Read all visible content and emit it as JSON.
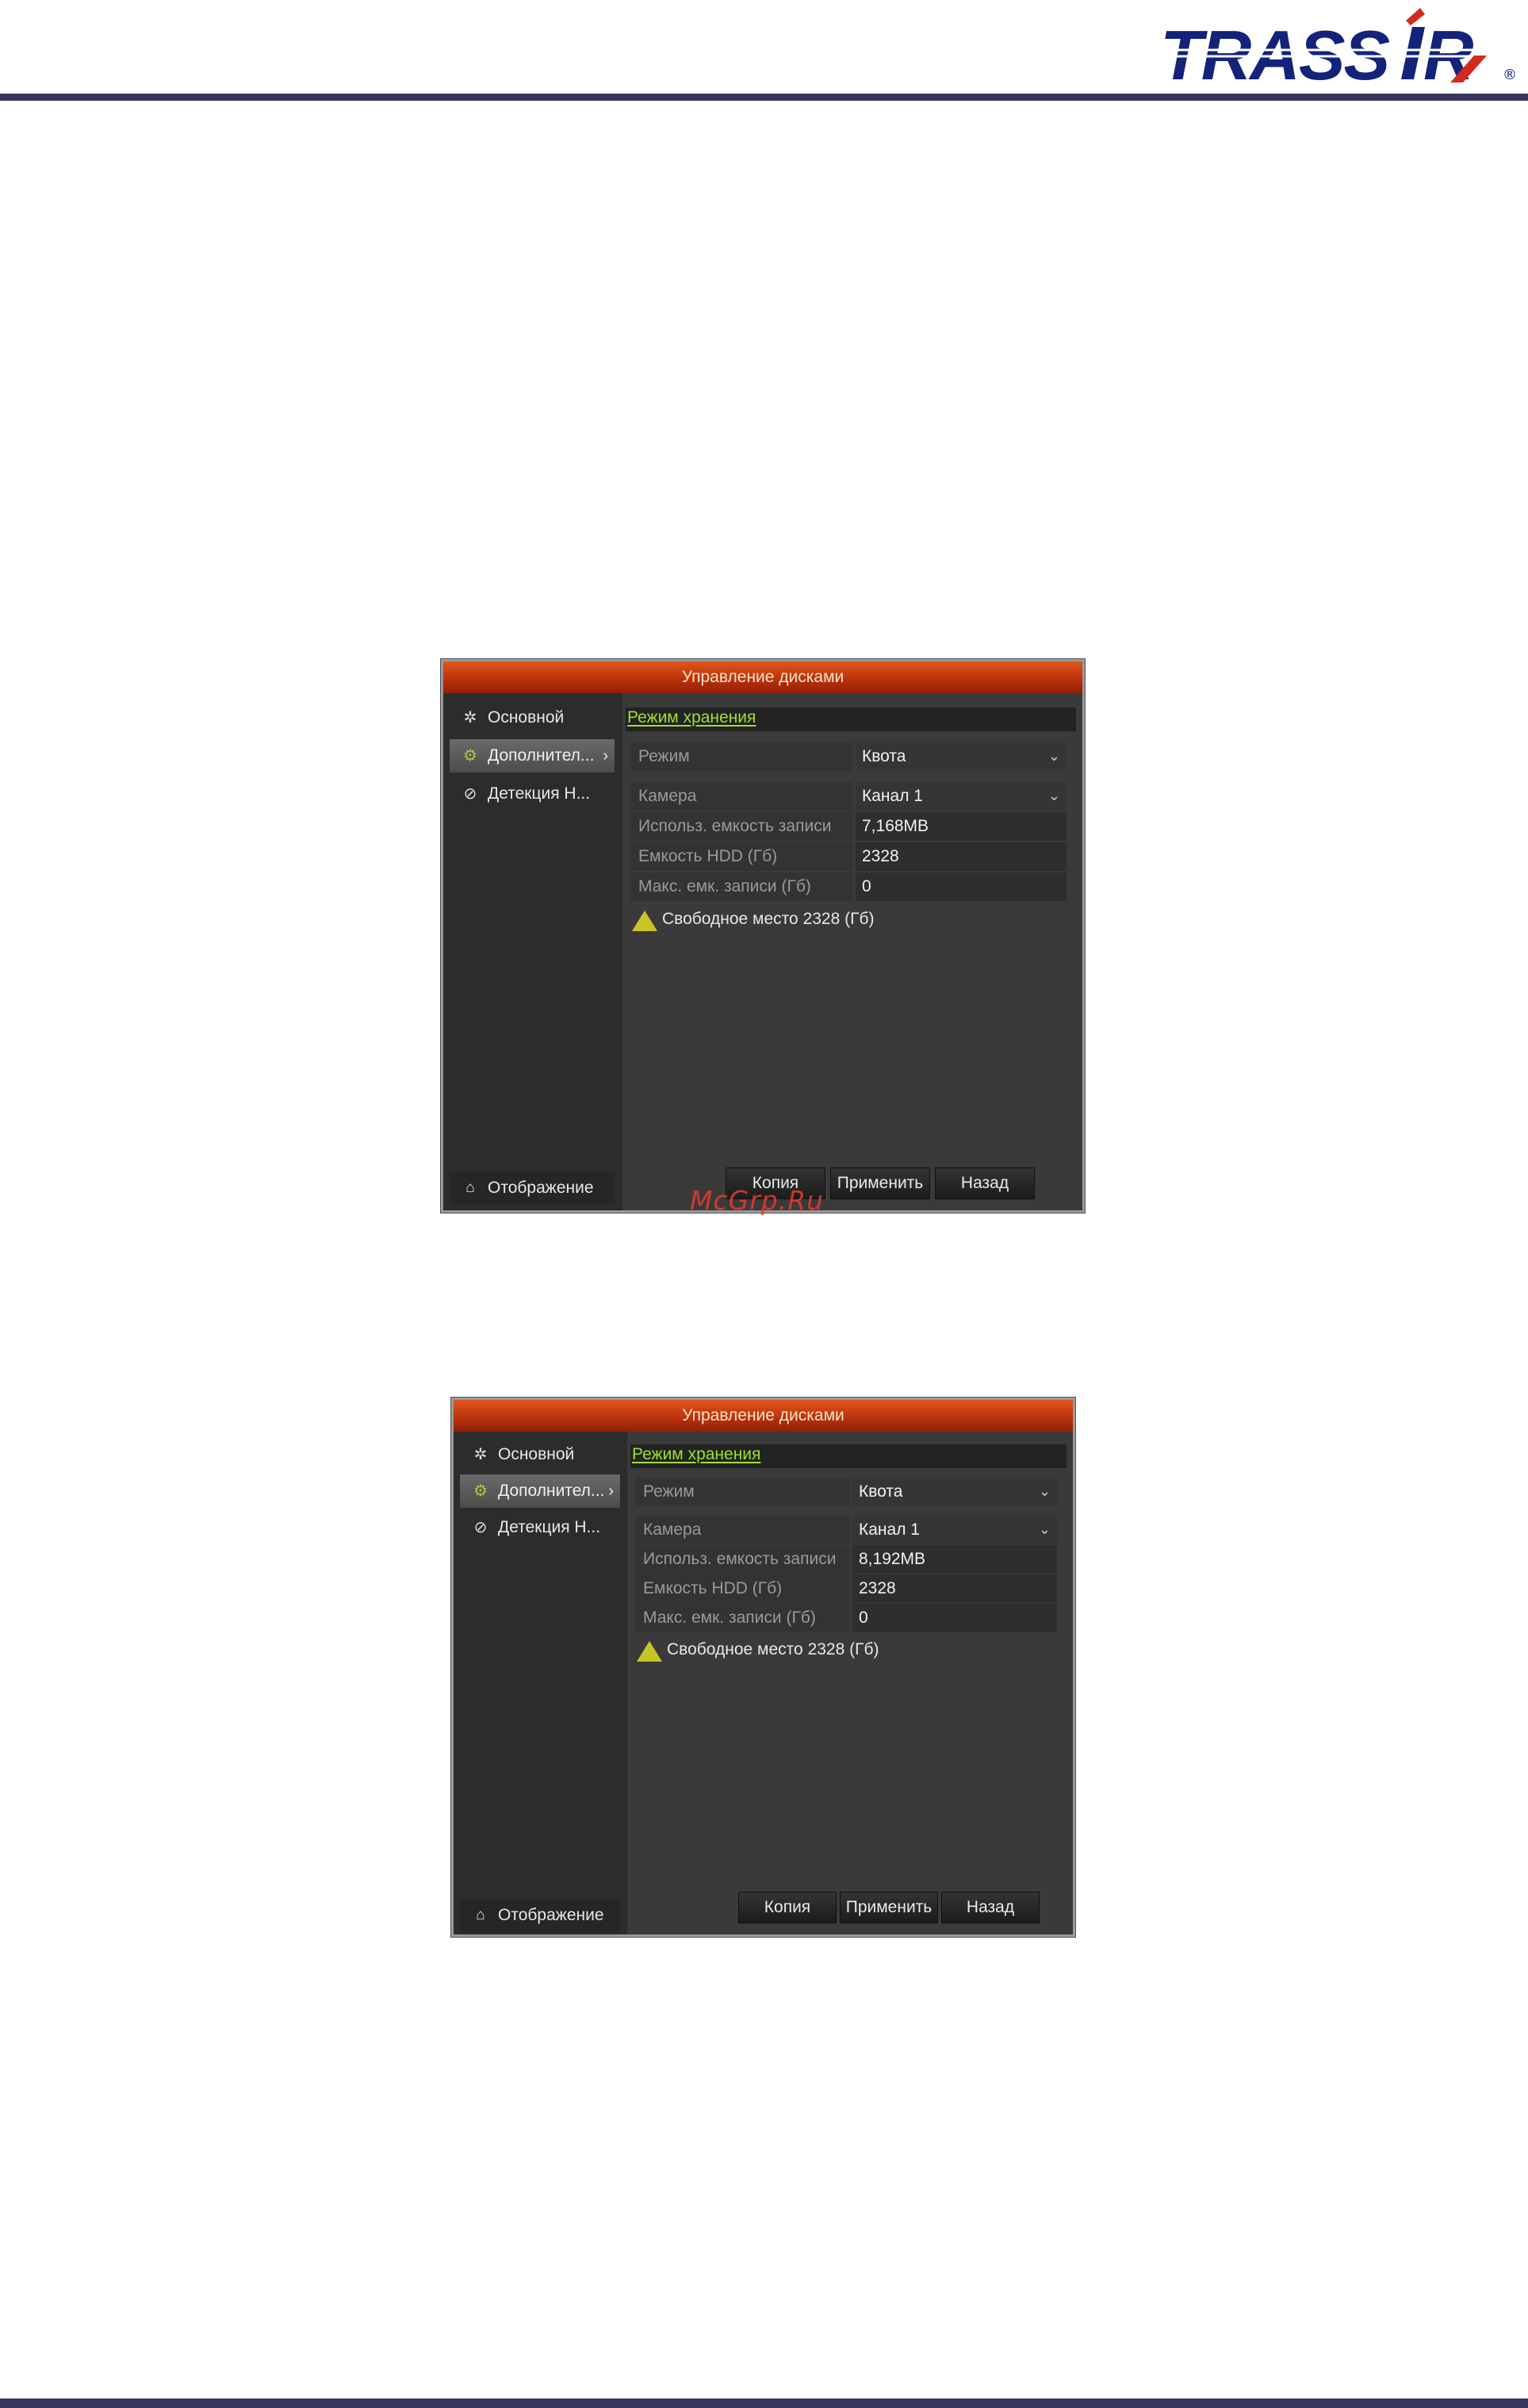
{
  "brand": {
    "logo_text": "TRASSIR",
    "accent_color": "#14237a",
    "rule_color": "#37375e"
  },
  "watermark": "McGrp.Ru",
  "screens": [
    {
      "title": "Управление дисками",
      "sidebar": {
        "items": [
          {
            "label": "Основной",
            "icon": "gear-icon"
          },
          {
            "label": "Дополнител...",
            "icon": "hdd-gear-icon",
            "active": true
          },
          {
            "label": "Детекция Н...",
            "icon": "shield-check-icon"
          }
        ],
        "bottom": {
          "label": "Отображение",
          "icon": "home-icon"
        }
      },
      "section_title": "Режим хранения",
      "mode": {
        "label": "Режим",
        "value": "Квота"
      },
      "camera": {
        "label": "Камера",
        "value": "Канал 1"
      },
      "used": {
        "label": "Использ. емкость записи",
        "value": "7,168MB"
      },
      "hdd": {
        "label": "Емкость HDD (Гб)",
        "value": "2328"
      },
      "max": {
        "label": "Макс. емк. записи (Гб)",
        "value": "0"
      },
      "free_note": "Свободное место 2328 (Гб)",
      "buttons": {
        "copy": "Копия",
        "apply": "Применить",
        "back": "Назад"
      }
    },
    {
      "title": "Управление дисками",
      "sidebar": {
        "items": [
          {
            "label": "Основной",
            "icon": "gear-icon"
          },
          {
            "label": "Дополнител...",
            "icon": "hdd-gear-icon",
            "active": true
          },
          {
            "label": "Детекция Н...",
            "icon": "shield-check-icon"
          }
        ],
        "bottom": {
          "label": "Отображение",
          "icon": "home-icon"
        }
      },
      "section_title": "Режим хранения",
      "mode": {
        "label": "Режим",
        "value": "Квота"
      },
      "camera": {
        "label": "Камера",
        "value": "Канал 1"
      },
      "used": {
        "label": "Использ. емкость записи",
        "value": "8,192MB"
      },
      "hdd": {
        "label": "Емкость HDD (Гб)",
        "value": "2328"
      },
      "max": {
        "label": "Макс. емк. записи (Гб)",
        "value": "0"
      },
      "free_note": "Свободное место 2328 (Гб)",
      "buttons": {
        "copy": "Копия",
        "apply": "Применить",
        "back": "Назад"
      }
    }
  ]
}
